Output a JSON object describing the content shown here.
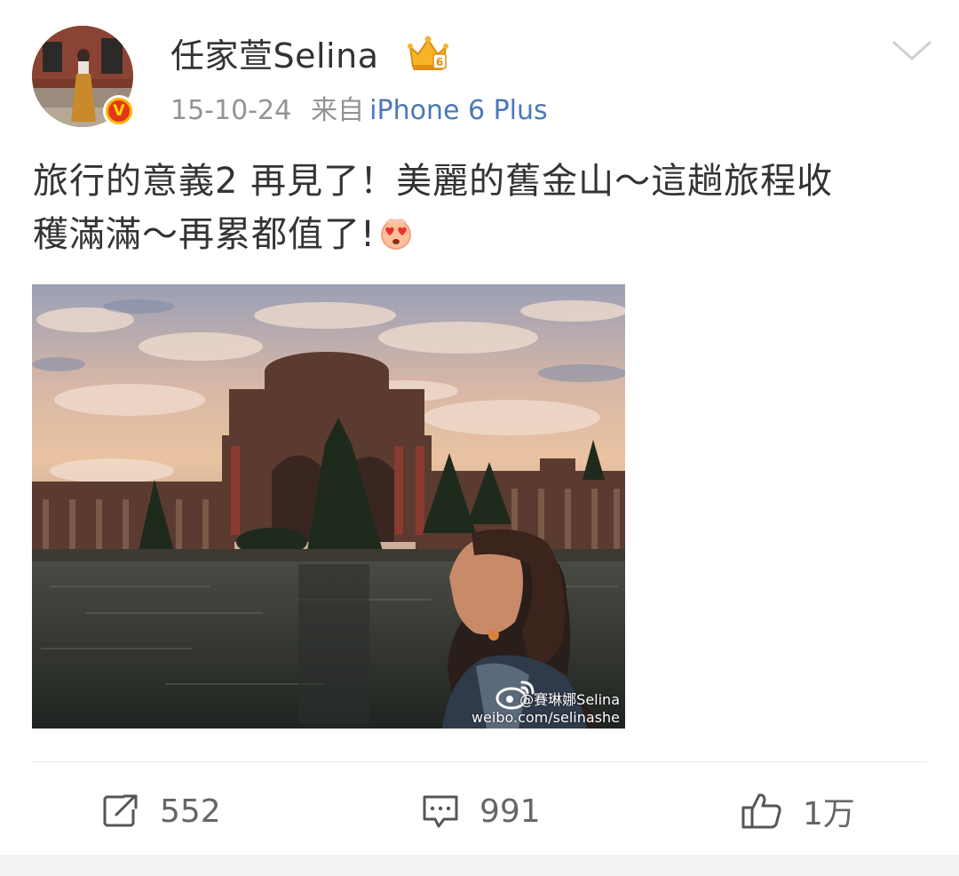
{
  "post": {
    "user": {
      "name": "任家萱Selina",
      "avatar_icon": "avatar-photo",
      "verified_icon": "verified-v-icon",
      "verified_badge_text": "V",
      "member_icon": "crown-vip-icon",
      "member_level": "6"
    },
    "meta": {
      "date": "15-10-24",
      "from_label": "来自",
      "device": "iPhone 6 Plus"
    },
    "text": {
      "line1": "旅行的意義2  再見了！美麗的舊金山～這趟旅程收",
      "line2": "穫滿滿～再累都值了!"
    },
    "image": {
      "watermark_handle": "@賽琳娜Selina",
      "watermark_url": "weibo.com/selinashe"
    },
    "actions": {
      "repost_count": "552",
      "comment_count": "991",
      "like_count": "1万"
    }
  },
  "colors": {
    "link_blue": "#4b79b4",
    "meta_gray": "#939393",
    "text": "#333333",
    "verified_orange": "#f7b500"
  }
}
